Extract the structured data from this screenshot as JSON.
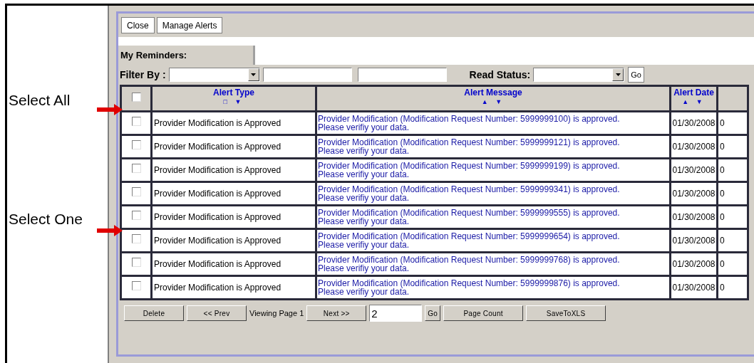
{
  "annotations": [
    {
      "label": "Select All"
    },
    {
      "label": "Select One"
    }
  ],
  "toolbar": {
    "buttons": [
      "Close",
      "Manage Alerts"
    ]
  },
  "tab": {
    "label": "My Reminders:"
  },
  "filter": {
    "label": "Filter By :",
    "read_status_label": "Read Status:",
    "go": "Go"
  },
  "table": {
    "select_all": {
      "checked": false
    },
    "columns": [
      {
        "label": "Alert Type",
        "sort": [
          "□",
          "▼"
        ]
      },
      {
        "label": "Alert Message",
        "sort": [
          "▲",
          "▼"
        ]
      },
      {
        "label": "Alert Date",
        "sort": [
          "▲",
          "▼"
        ]
      }
    ],
    "rows": [
      {
        "checked": false,
        "type": "Provider Modification is Approved",
        "message": "Provider Modification (Modification Request Number: 5999999100) is approved. Please verifiy your data.",
        "date": "01/30/2008",
        "column_5": "0"
      },
      {
        "checked": false,
        "type": "Provider Modification is Approved",
        "message": "Provider Modification (Modification Request Number: 5999999121) is approved. Please verifiy your data.",
        "date": "01/30/2008",
        "column_5": "0"
      },
      {
        "checked": false,
        "type": "Provider Modification is Approved",
        "message": "Provider Modification (Modification Request Number: 5999999199) is approved. Please verifiy your data.",
        "date": "01/30/2008",
        "column_5": "0"
      },
      {
        "checked": false,
        "type": "Provider Modification is Approved",
        "message": "Provider Modification (Modification Request Number: 5999999341) is approved. Please verifiy your data.",
        "date": "01/30/2008",
        "column_5": "0"
      },
      {
        "checked": false,
        "type": "Provider Modification is Approved",
        "message": "Provider Modification (Modification Request Number: 5999999555) is approved. Please verifiy your data.",
        "date": "01/30/2008",
        "column_5": "0"
      },
      {
        "checked": false,
        "type": "Provider Modification is Approved",
        "message": "Provider Modification (Modification Request Number: 5999999654) is approved. Please verifiy your data.",
        "date": "01/30/2008",
        "column_5": "0"
      },
      {
        "checked": false,
        "type": "Provider Modification is Approved",
        "message": "Provider Modification (Modification Request Number: 5999999768) is approved. Please verifiy your data.",
        "date": "01/30/2008",
        "column_5": "0"
      },
      {
        "checked": false,
        "type": "Provider Modification is Approved",
        "message": "Provider Modification (Modification Request Number: 5999999876) is approved. Please verifiy your data.",
        "date": "01/30/2008",
        "column_5": "0"
      }
    ]
  },
  "pager": {
    "delete": "Delete",
    "prev": "<< Prev",
    "viewing": "Viewing Page 1",
    "next": "Next >>",
    "page_value": "2",
    "go": "Go",
    "page_count": "Page Count",
    "save": "SaveToXLS"
  }
}
